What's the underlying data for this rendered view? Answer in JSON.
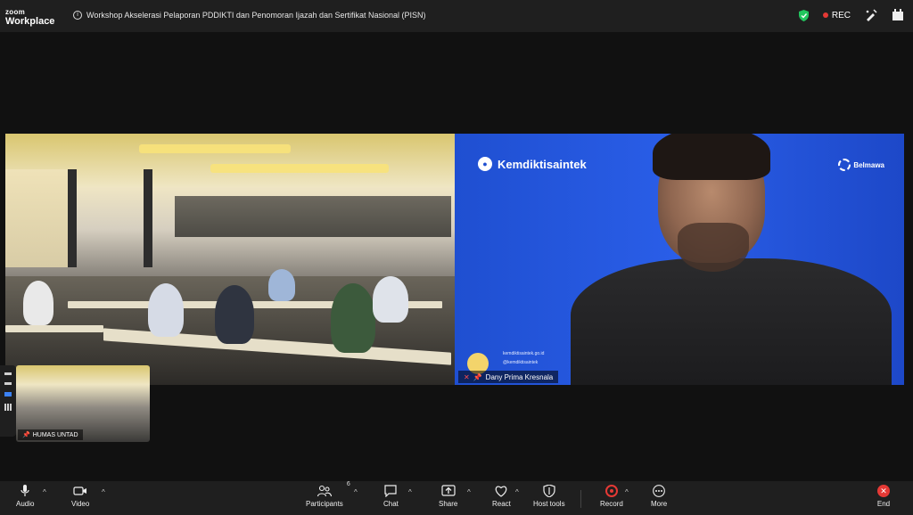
{
  "app": {
    "brand_line1": "zoom",
    "brand_line2": "Workplace"
  },
  "meeting": {
    "title": "Workshop Akselerasi Pelaporan PDDIKTI dan Penomoran Ijazah dan Sertifikat Nasional (PISN)"
  },
  "header": {
    "rec_label": "REC"
  },
  "speaker_tile": {
    "brand_text": "Kemdiktisaintek",
    "partner_text": "Belmawa",
    "card_url": "kemdiktisaintek.go.id",
    "card_social": "@kemdiktisaintek",
    "participant_name": "Dany Prima Kresnala"
  },
  "thumbnail": {
    "participant_name": "HUMAS UNTAD"
  },
  "toolbar": {
    "audio": "Audio",
    "video": "Video",
    "participants": "Participants",
    "participants_count": "6",
    "chat": "Chat",
    "share": "Share",
    "react": "React",
    "host_tools": "Host tools",
    "record": "Record",
    "more": "More",
    "end": "End"
  },
  "colors": {
    "accent_red": "#e53935",
    "speaker_bg": "#2a5ee8",
    "shield_green": "#22c55e"
  }
}
